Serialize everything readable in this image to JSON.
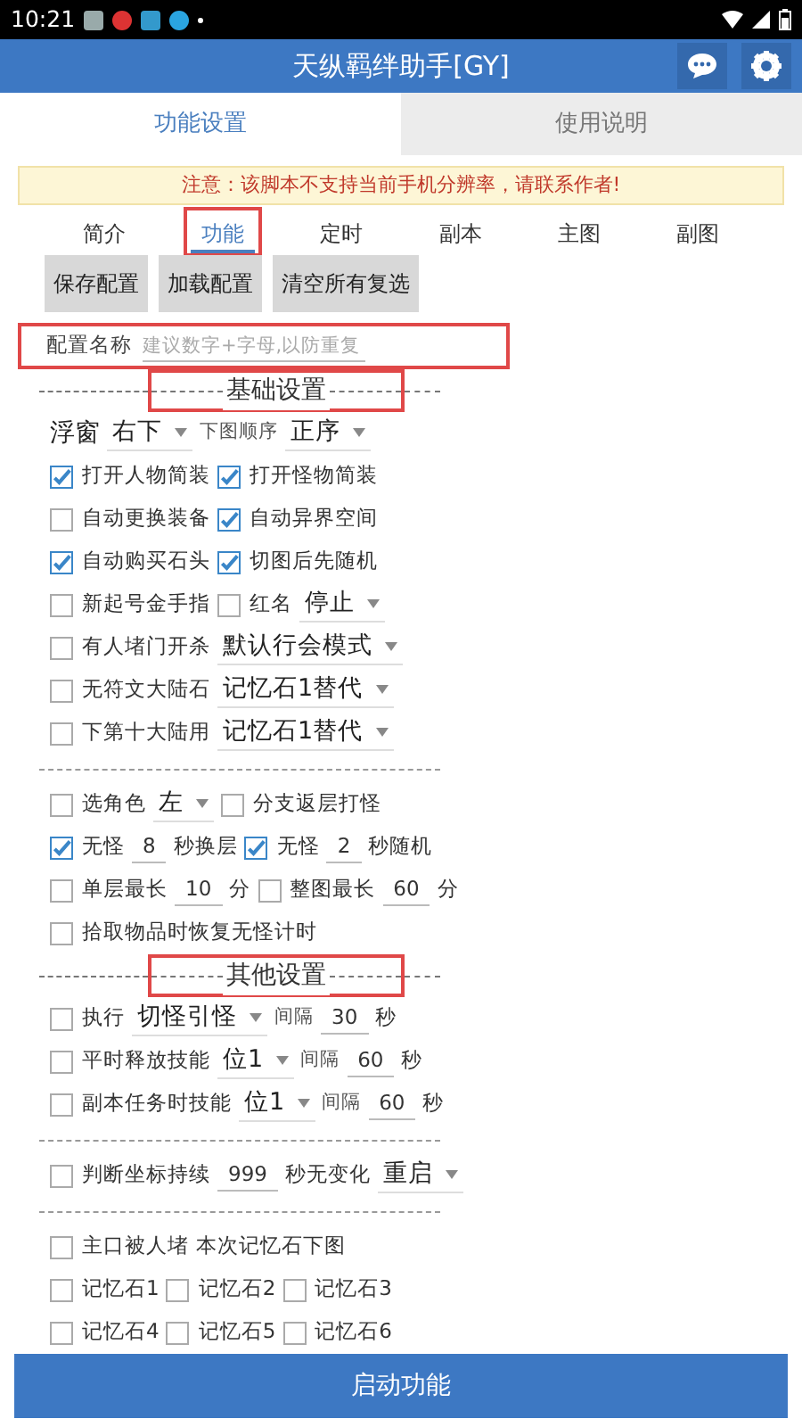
{
  "status_bar": {
    "time": "10:21"
  },
  "app_bar": {
    "title": "天纵羁绊助手[GY]"
  },
  "tabs": [
    {
      "label": "功能设置",
      "selected": true
    },
    {
      "label": "使用说明",
      "selected": false
    }
  ],
  "notice": "注意：该脚本不支持当前手机分辨率，请联系作者!",
  "sub_tabs": [
    {
      "label": "简介",
      "selected": false,
      "highlighted": false
    },
    {
      "label": "功能",
      "selected": true,
      "highlighted": true
    },
    {
      "label": "定时",
      "selected": false,
      "highlighted": false
    },
    {
      "label": "副本",
      "selected": false,
      "highlighted": false
    },
    {
      "label": "主图",
      "selected": false,
      "highlighted": false
    },
    {
      "label": "副图",
      "selected": false,
      "highlighted": false
    }
  ],
  "buttons": [
    "保存配置",
    "加载配置",
    "清空所有复选"
  ],
  "config_name": {
    "label": "配置名称",
    "placeholder": "建议数字+字母,以防重复",
    "highlighted": true
  },
  "blocks": [
    {
      "kind": "header",
      "title": "基础设置",
      "highlighted": true,
      "rows": [
        {
          "items": [
            {
              "kind": "big_label",
              "text": "浮窗"
            },
            {
              "kind": "select",
              "value": "右下"
            },
            {
              "kind": "small_label",
              "text": "下图顺序"
            },
            {
              "kind": "select",
              "value": "正序"
            }
          ]
        },
        {
          "items": [
            {
              "kind": "check",
              "label": "打开人物简装",
              "checked": true
            },
            {
              "kind": "check",
              "label": "打开怪物简装",
              "checked": true
            }
          ]
        },
        {
          "items": [
            {
              "kind": "check",
              "label": "自动更换装备",
              "checked": false
            },
            {
              "kind": "check",
              "label": "自动异界空间",
              "checked": true
            }
          ]
        },
        {
          "items": [
            {
              "kind": "check",
              "label": "自动购买石头",
              "checked": true
            },
            {
              "kind": "check",
              "label": "切图后先随机",
              "checked": true
            }
          ]
        },
        {
          "items": [
            {
              "kind": "check",
              "label": "新起号金手指",
              "checked": false
            },
            {
              "kind": "check",
              "label": "红名",
              "checked": false
            },
            {
              "kind": "select",
              "value": "停止"
            }
          ]
        },
        {
          "items": [
            {
              "kind": "check",
              "label": "有人堵门开杀",
              "checked": false
            },
            {
              "kind": "select",
              "value": "默认行会模式"
            }
          ]
        },
        {
          "items": [
            {
              "kind": "check",
              "label": "无符文大陆石",
              "checked": false
            },
            {
              "kind": "select",
              "value": "记忆石1替代"
            }
          ]
        },
        {
          "items": [
            {
              "kind": "check",
              "label": "下第十大陆用",
              "checked": false
            },
            {
              "kind": "select",
              "value": "记忆石1替代"
            }
          ]
        }
      ]
    },
    {
      "kind": "divider",
      "rows": [
        {
          "items": [
            {
              "kind": "check",
              "label": "选角色",
              "checked": false
            },
            {
              "kind": "select",
              "value": "左"
            },
            {
              "kind": "check",
              "label": "分支返层打怪",
              "checked": false
            }
          ]
        },
        {
          "items": [
            {
              "kind": "check",
              "label": "无怪",
              "checked": true
            },
            {
              "kind": "number",
              "value": "8"
            },
            {
              "kind": "label",
              "text": "秒换层"
            },
            {
              "kind": "check",
              "label": "无怪",
              "checked": true
            },
            {
              "kind": "number",
              "value": "2"
            },
            {
              "kind": "label",
              "text": "秒随机"
            }
          ]
        },
        {
          "items": [
            {
              "kind": "check",
              "label": "单层最长",
              "checked": false
            },
            {
              "kind": "number",
              "value": "10"
            },
            {
              "kind": "label",
              "text": "分"
            },
            {
              "kind": "check",
              "label": "整图最长",
              "checked": false
            },
            {
              "kind": "number",
              "value": "60"
            },
            {
              "kind": "label",
              "text": "分"
            }
          ]
        },
        {
          "items": [
            {
              "kind": "check",
              "label": "拾取物品时恢复无怪计时",
              "checked": false
            }
          ]
        }
      ]
    },
    {
      "kind": "header",
      "title": "其他设置",
      "highlighted": true,
      "rows": [
        {
          "items": [
            {
              "kind": "check",
              "label": "执行",
              "checked": false
            },
            {
              "kind": "select",
              "value": "切怪引怪"
            },
            {
              "kind": "small_label",
              "text": "间隔"
            },
            {
              "kind": "number",
              "value": "30"
            },
            {
              "kind": "label",
              "text": "秒"
            }
          ]
        },
        {
          "items": [
            {
              "kind": "check",
              "label": "平时释放技能",
              "checked": false
            },
            {
              "kind": "select",
              "value": "位1"
            },
            {
              "kind": "small_label",
              "text": "间隔"
            },
            {
              "kind": "number",
              "value": "60"
            },
            {
              "kind": "label",
              "text": "秒"
            }
          ]
        },
        {
          "items": [
            {
              "kind": "check",
              "label": "副本任务时技能",
              "checked": false
            },
            {
              "kind": "select",
              "value": "位1"
            },
            {
              "kind": "small_label",
              "text": "间隔"
            },
            {
              "kind": "number",
              "value": "60"
            },
            {
              "kind": "label",
              "text": "秒"
            }
          ]
        }
      ]
    },
    {
      "kind": "divider",
      "rows": [
        {
          "items": [
            {
              "kind": "check",
              "label": "判断坐标持续",
              "checked": false
            },
            {
              "kind": "number",
              "value": "999"
            },
            {
              "kind": "label",
              "text": "秒无变化"
            },
            {
              "kind": "select",
              "value": "重启"
            }
          ]
        }
      ]
    },
    {
      "kind": "divider",
      "rows": [
        {
          "items": [
            {
              "kind": "check",
              "label": "主口被人堵",
              "checked": false
            },
            {
              "kind": "label",
              "text": "本次记忆石下图"
            }
          ]
        },
        {
          "items": [
            {
              "kind": "check",
              "label": "记忆石1",
              "checked": false
            },
            {
              "kind": "check",
              "label": "记忆石2",
              "checked": false
            },
            {
              "kind": "check",
              "label": "记忆石3",
              "checked": false
            }
          ]
        },
        {
          "items": [
            {
              "kind": "check",
              "label": "记忆石4",
              "checked": false
            },
            {
              "kind": "check",
              "label": "记忆石5",
              "checked": false
            },
            {
              "kind": "check",
              "label": "记忆石6",
              "checked": false
            }
          ]
        }
      ]
    }
  ],
  "start_button": "启动功能"
}
